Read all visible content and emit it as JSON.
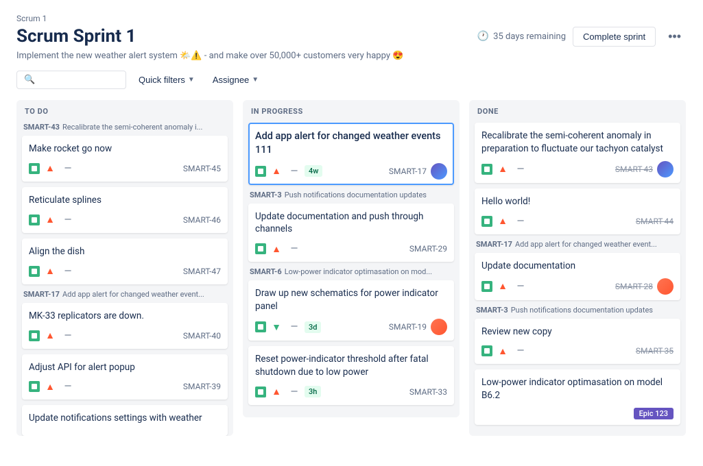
{
  "breadcrumb": "Scrum 1",
  "title": "Scrum Sprint 1",
  "subtitle": "Implement the new weather alert system 🌤️⚠️ - and make over 50,000+ customers very happy 😍",
  "header": {
    "days_remaining": "35 days remaining",
    "complete_btn": "Complete sprint",
    "more_icon": "•••"
  },
  "toolbar": {
    "search_placeholder": "",
    "quick_filters": "Quick filters",
    "assignee": "Assignee"
  },
  "columns": [
    {
      "id": "todo",
      "label": "TO DO",
      "groups": [
        {
          "epic_id": "SMART-43",
          "epic_label": "Recalibrate the semi-coherent anomaly i...",
          "cards": [
            {
              "title": "Make rocket go now",
              "actions": [
                "story",
                "priority-up",
                "minus"
              ],
              "id": "SMART-45",
              "id_strikethrough": false
            },
            {
              "title": "Reticulate splines",
              "actions": [
                "story",
                "priority-up",
                "minus"
              ],
              "id": "SMART-46",
              "id_strikethrough": false
            },
            {
              "title": "Align the dish",
              "actions": [
                "story",
                "priority-up",
                "minus"
              ],
              "id": "SMART-47",
              "id_strikethrough": false
            }
          ]
        },
        {
          "epic_id": "SMART-17",
          "epic_label": "Add app alert for changed weather event...",
          "cards": [
            {
              "title": "MK-33 replicators are down.",
              "actions": [
                "story",
                "priority-up",
                "minus"
              ],
              "id": "SMART-40",
              "id_strikethrough": false
            },
            {
              "title": "Adjust API for alert popup",
              "actions": [
                "story",
                "priority-up",
                "minus"
              ],
              "id": "SMART-39",
              "id_strikethrough": false
            },
            {
              "title": "Update notifications settings with weather",
              "actions": [],
              "id": "",
              "id_strikethrough": false
            }
          ]
        }
      ]
    },
    {
      "id": "inprogress",
      "label": "IN PROGRESS",
      "groups": [
        {
          "epic_id": null,
          "epic_label": null,
          "cards": [
            {
              "title": "Add app alert for changed weather events 111",
              "highlighted": true,
              "actions": [
                "story",
                "priority-up",
                "minus"
              ],
              "time": "4w",
              "id": "SMART-17",
              "avatar": "1"
            }
          ]
        },
        {
          "epic_id": "SMART-3",
          "epic_label": "Push notifications documentation updates",
          "cards": [
            {
              "title": "Update documentation and push through channels",
              "actions": [
                "story",
                "priority-up",
                "minus"
              ],
              "id": "SMART-29"
            }
          ]
        },
        {
          "epic_id": "SMART-6",
          "epic_label": "Low-power indicator optimasation on mod...",
          "cards": [
            {
              "title": "Draw up new schematics for power indicator panel",
              "actions": [
                "story",
                "priority-down",
                "minus"
              ],
              "time": "3d",
              "id": "SMART-19",
              "avatar": "2"
            },
            {
              "title": "Reset power-indicator threshold after fatal shutdown due to low power",
              "actions": [
                "story",
                "priority-up",
                "minus"
              ],
              "time": "3h",
              "id": "SMART-33"
            }
          ]
        }
      ]
    },
    {
      "id": "done",
      "label": "DONE",
      "groups": [
        {
          "epic_id": null,
          "epic_label": null,
          "cards": [
            {
              "title": "Recalibrate the semi-coherent anomaly in preparation to fluctuate our tachyon catalyst",
              "actions": [
                "story",
                "priority-up",
                "minus"
              ],
              "id": "SMART-43",
              "id_strikethrough": true,
              "avatar": "1"
            }
          ]
        },
        {
          "epic_id": null,
          "epic_label": null,
          "cards": [
            {
              "title": "Hello world!",
              "actions": [
                "story",
                "priority-up",
                "minus"
              ],
              "id": "SMART-44",
              "id_strikethrough": true
            }
          ]
        },
        {
          "epic_id": "SMART-17",
          "epic_label": "Add app alert for changed weather event...",
          "cards": [
            {
              "title": "Update documentation",
              "actions": [
                "story",
                "priority-up",
                "minus"
              ],
              "id": "SMART-28",
              "id_strikethrough": true,
              "avatar": "2"
            }
          ]
        },
        {
          "epic_id": "SMART-3",
          "epic_label": "Push notifications documentation updates",
          "cards": [
            {
              "title": "Review new copy",
              "actions": [
                "story",
                "priority-up",
                "minus"
              ],
              "id": "SMART-35",
              "id_strikethrough": true
            }
          ]
        },
        {
          "epic_id": null,
          "epic_label": null,
          "cards": [
            {
              "title": "Low-power indicator optimasation on model B6.2",
              "actions": [],
              "id": "",
              "id_strikethrough": false,
              "epic_tag": "Epic 123"
            }
          ]
        }
      ]
    }
  ]
}
